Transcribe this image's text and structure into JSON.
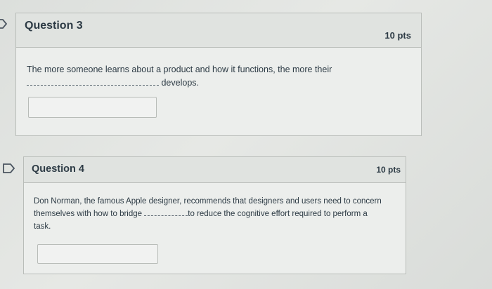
{
  "questions": [
    {
      "title": "Question 3",
      "points": "10 pts",
      "text_line1": "The more someone learns about a product and how it functions, the more their",
      "text_after_blank": "develops.",
      "answer_value": ""
    },
    {
      "title": "Question 4",
      "points": "10 pts",
      "text_line1": "Don Norman, the famous Apple designer, recommends that designers and users need to concern",
      "text_before_blank": "themselves with how to bridge",
      "text_after_blank": "to reduce the cognitive effort required to perform a",
      "text_line3": "task.",
      "answer_value": ""
    }
  ],
  "icons": {
    "q3_marker": "flag-outline-icon",
    "q4_marker": "flag-outline-icon"
  }
}
